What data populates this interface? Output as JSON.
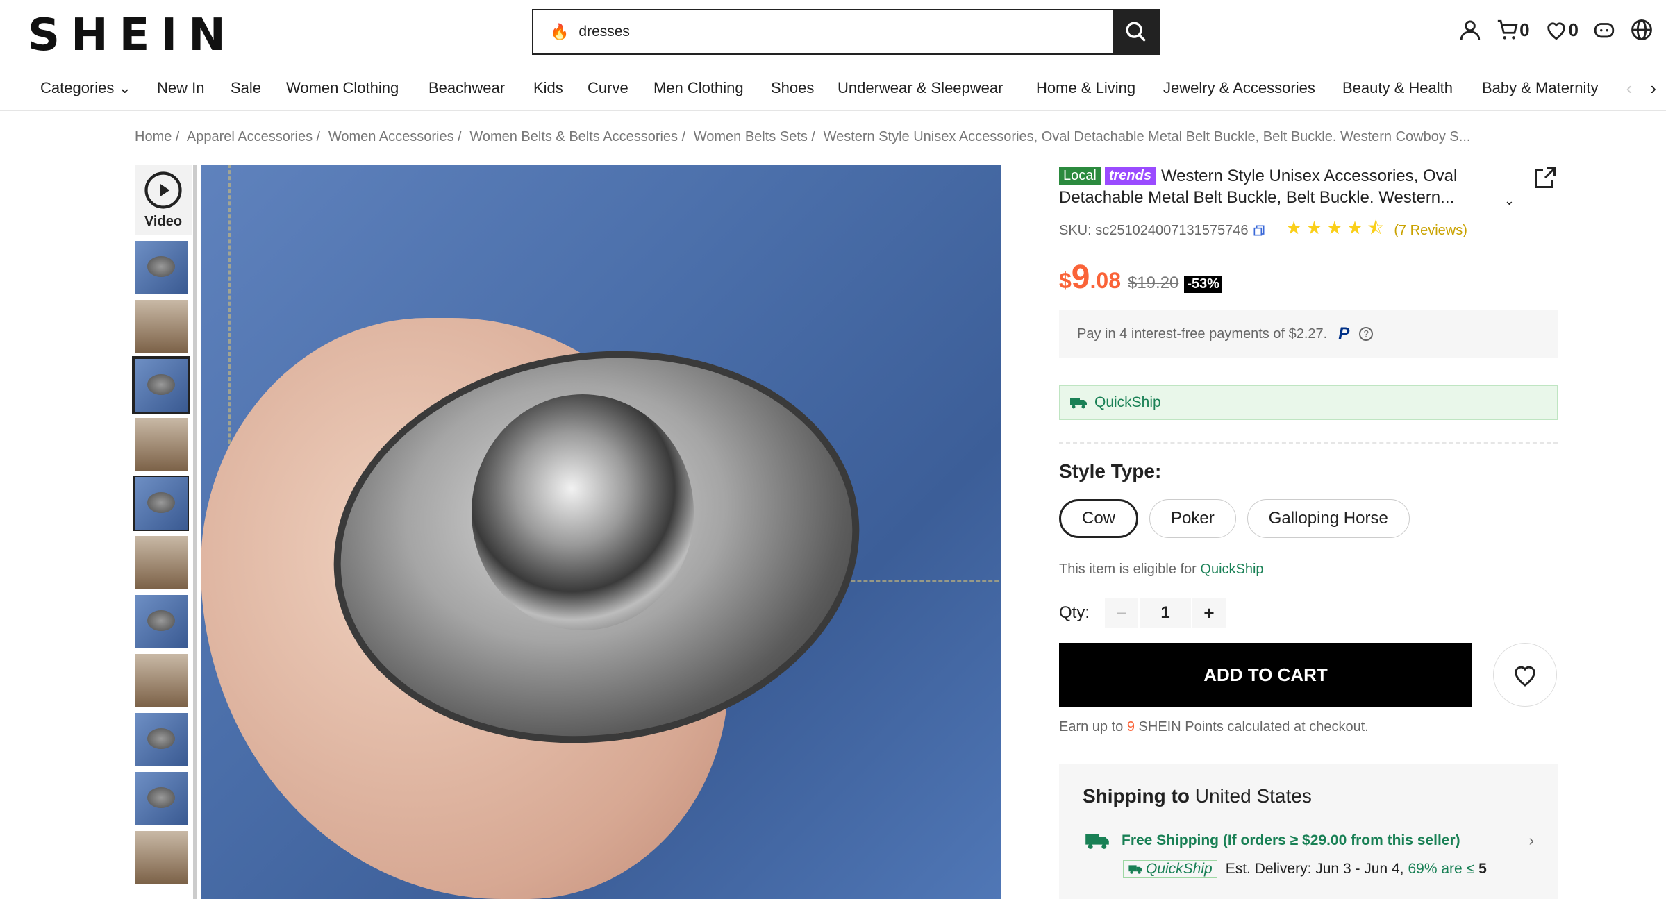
{
  "header": {
    "logo": "SHEIN",
    "search_value": "dresses",
    "cart_count": "0",
    "wishlist_count": "0"
  },
  "nav": {
    "items": [
      "Categories",
      "New In",
      "Sale",
      "Women Clothing",
      "Beachwear",
      "Kids",
      "Curve",
      "Men Clothing",
      "Shoes",
      "Underwear & Sleepwear",
      "Home & Living",
      "Jewelry & Accessories",
      "Beauty & Health",
      "Baby & Maternity"
    ]
  },
  "breadcrumb": [
    "Home /",
    "Apparel Accessories /",
    "Women Accessories /",
    "Women Belts & Belts Accessories /",
    "Women Belts Sets /",
    "Western Style Unisex Accessories, Oval Detachable Metal Belt Buckle, Belt Buckle. Western Cowboy S..."
  ],
  "gallery": {
    "video_label": "Video"
  },
  "product": {
    "tag_local": "Local",
    "tag_trends": "trends",
    "title": "Western Style Unisex Accessories, Oval Detachable Metal Belt Buckle, Belt Buckle. Western...",
    "sku": "SKU: sc251024007131575746",
    "rating": 4.5,
    "reviews": "(7 Reviews)",
    "price_currency": "$",
    "price_int": "9",
    "price_dec": ".08",
    "price_old": "$19.20",
    "discount": "-53%",
    "pay_text": "Pay in 4 interest-free payments of $2.27.",
    "paypal": "P",
    "quickship_label": "QuickShip",
    "style_title": "Style Type:",
    "style_options": [
      "Cow",
      "Poker",
      "Galloping Horse"
    ],
    "eligible_prefix": "This item is eligible for",
    "eligible_link": "QuickShip",
    "qty_label": "Qty:",
    "qty_minus": "−",
    "qty_value": "1",
    "qty_plus": "+",
    "add_to_cart": "ADD TO CART",
    "points_prefix": "Earn up to",
    "points_num": "9",
    "points_suffix": "SHEIN Points calculated at checkout."
  },
  "shipping": {
    "title_bold": "Shipping to",
    "country": "United States",
    "free_text": "Free Shipping (If orders ≥ $29.00 from this seller)",
    "qs_tag": "QuickShip",
    "est": "Est. Delivery: Jun 3 - Jun 4,",
    "pct": "69% are ≤",
    "pct_days": "5"
  },
  "colors": {
    "accent": "#fa6338",
    "quickship_green": "#198055",
    "star": "#facf19"
  }
}
